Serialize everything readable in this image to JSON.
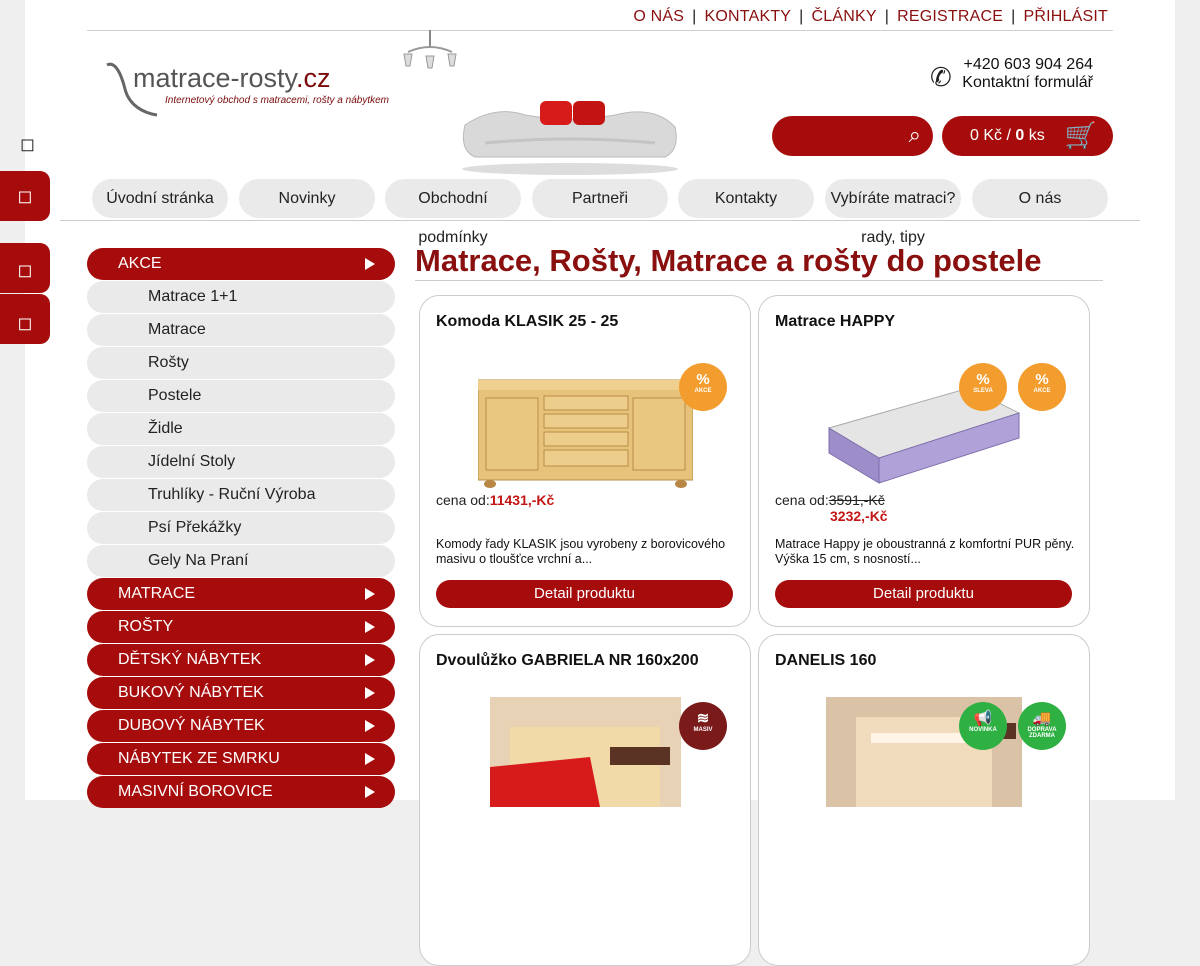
{
  "top_links": [
    "O NÁS",
    "KONTAKTY",
    "ČLÁNKY",
    "REGISTRACE",
    "PŘIHLÁSIT"
  ],
  "logo": {
    "brand": "matrace-rosty",
    "tld": ".cz",
    "tagline": "Internetový obchod s matracemi, rošty a nábytkem"
  },
  "contact": {
    "phone": "+420 603 904 264",
    "form_link": "Kontaktní formulář"
  },
  "cart": {
    "price": "0 Kč",
    "sep": " / ",
    "count": "0",
    "unit": " ks"
  },
  "nav": [
    {
      "label": "Úvodní stránka",
      "sub": ""
    },
    {
      "label": "Novinky",
      "sub": ""
    },
    {
      "label": "Obchodní",
      "sub": "podmínky"
    },
    {
      "label": "Partneři",
      "sub": ""
    },
    {
      "label": "Kontakty",
      "sub": ""
    },
    {
      "label": "Vybíráte matraci?",
      "sub": "rady, tipy"
    },
    {
      "label": "O nás",
      "sub": ""
    }
  ],
  "sidebar": {
    "akce": "AKCE",
    "akce_items": [
      "Matrace 1+1",
      "Matrace",
      "Rošty",
      "Postele",
      "Židle",
      "Jídelní Stoly",
      "Truhlíky - Ruční Výroba",
      "Psí Překážky",
      "Gely Na Praní"
    ],
    "categories": [
      "MATRACE",
      "ROŠTY",
      "DĚTSKÝ NÁBYTEK",
      "BUKOVÝ NÁBYTEK",
      "DUBOVÝ NÁBYTEK",
      "NÁBYTEK ZE SMRKU",
      "MASIVNÍ BOROVICE"
    ]
  },
  "main_title": "Matrace, Rošty, Matrace a rošty do postele",
  "price_label": "cena od:",
  "detail_label": "Detail produktu",
  "products": [
    {
      "name": "Komoda KLASIK 25 - 25",
      "price": "11431,-Kč",
      "old_price": "",
      "desc": "Komody řady KLASIK jsou vyrobeny z borovicového masivu o tloušťce vrchní a...",
      "badges": [
        "AKCE"
      ]
    },
    {
      "name": "Matrace HAPPY",
      "price": "3232,-Kč",
      "old_price": "3591,-Kč",
      "desc": "Matrace Happy je oboustranná z komfortní PUR pěny. Výška 15 cm, s nosností...",
      "badges": [
        "SLEVA",
        "AKCE"
      ]
    },
    {
      "name": "Dvoulůžko GABRIELA NR 160x200",
      "price": "",
      "old_price": "",
      "desc": "",
      "badges": [
        "MASIV"
      ]
    },
    {
      "name": "DANELIS 160",
      "price": "",
      "old_price": "",
      "desc": "",
      "badges": [
        "NOVINKA",
        "DOPRAVA ZDARMA"
      ]
    }
  ],
  "colors": {
    "accent": "#a60c0c",
    "title": "#8a0f0f",
    "pill": "#eaeaea"
  }
}
